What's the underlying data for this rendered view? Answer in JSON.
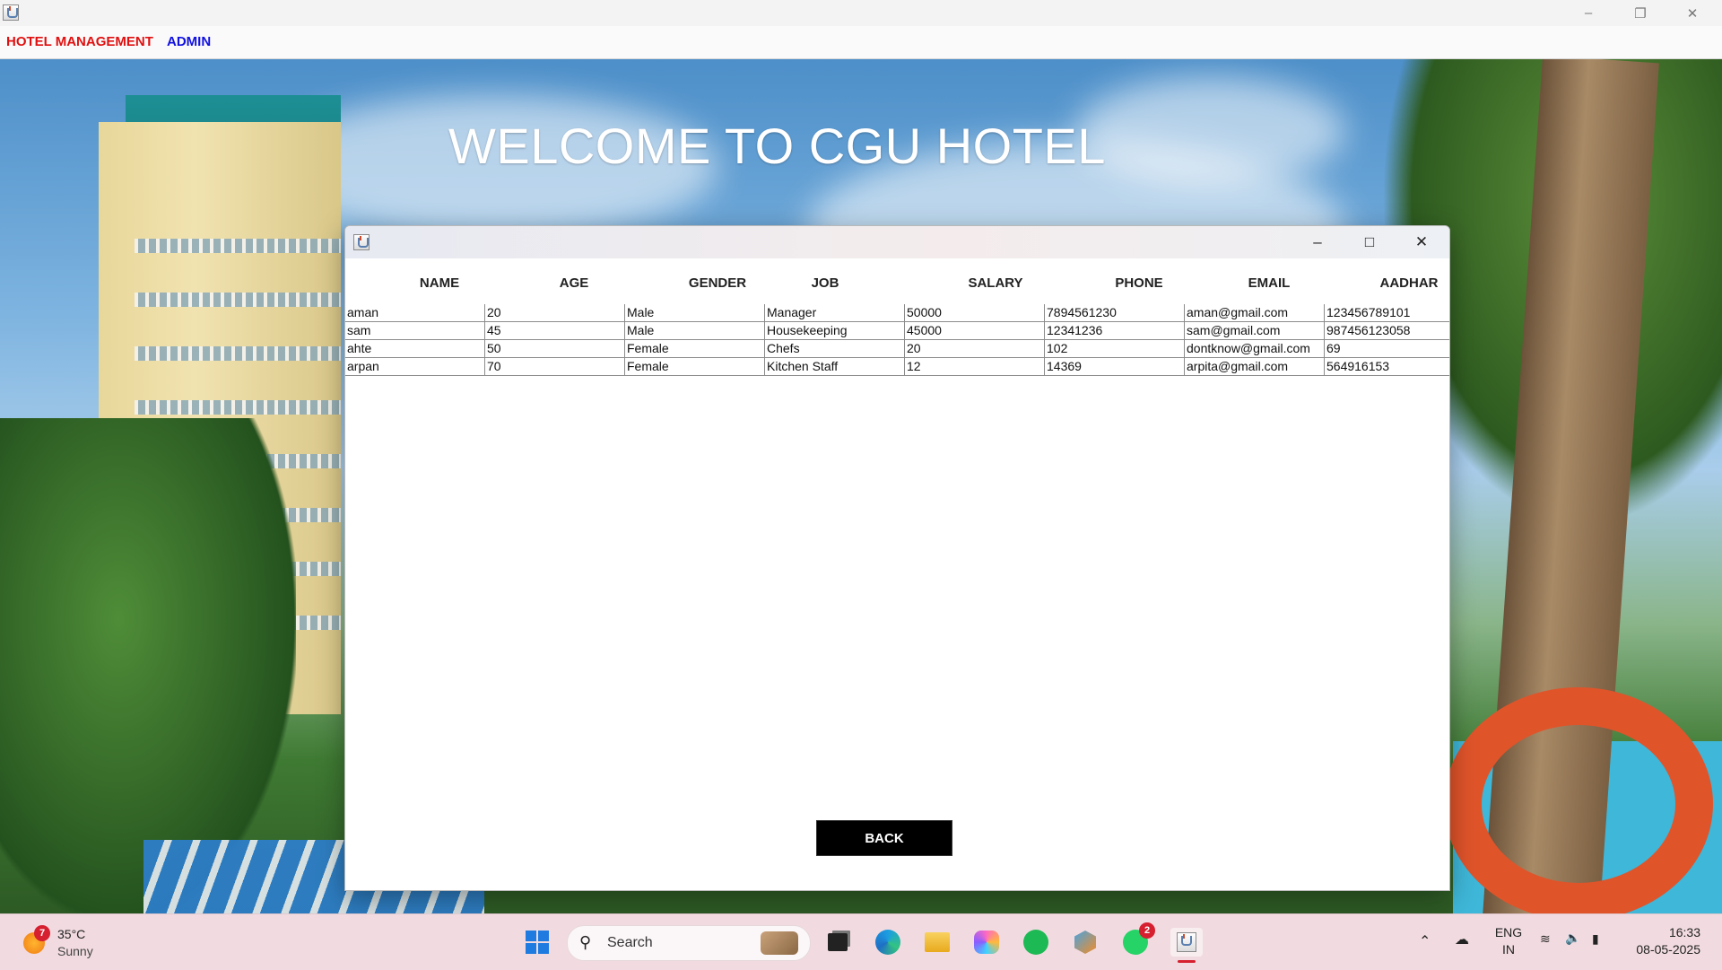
{
  "menubar": {
    "items": [
      {
        "label": "HOTEL MANAGEMENT",
        "color": "#e01010"
      },
      {
        "label": "ADMIN",
        "color": "#1010e0"
      }
    ]
  },
  "main": {
    "welcome_text": "WELCOME TO CGU HOTEL"
  },
  "dialog": {
    "columns": [
      "NAME",
      "AGE",
      "GENDER",
      "JOB",
      "SALARY",
      "PHONE",
      "EMAIL",
      "AADHAR"
    ],
    "rows": [
      [
        "aman",
        "20",
        "Male",
        "Manager",
        "50000",
        "7894561230",
        "aman@gmail.com",
        "123456789101"
      ],
      [
        "sam",
        "45",
        "Male",
        "Housekeeping",
        "45000",
        "12341236",
        "sam@gmail.com",
        "987456123058"
      ],
      [
        "ahte",
        "50",
        "Female",
        "Chefs",
        "20",
        "102",
        "dontknow@gmail.com",
        "69"
      ],
      [
        "arpan",
        "70",
        "Female",
        "Kitchen Staff",
        "12",
        "14369",
        "arpita@gmail.com",
        "564916153"
      ]
    ],
    "back_label": "BACK"
  },
  "taskbar": {
    "weather": {
      "temp": "35°C",
      "condition": "Sunny",
      "badge": "7"
    },
    "search_placeholder": "Search",
    "whatsapp_badge": "2",
    "language": {
      "line1": "ENG",
      "line2": "IN"
    },
    "clock": {
      "time": "16:33",
      "date": "08-05-2025"
    }
  },
  "colors": {
    "dialog_button_bg": "#000000",
    "taskbar_bg": "#f1dbe0"
  }
}
